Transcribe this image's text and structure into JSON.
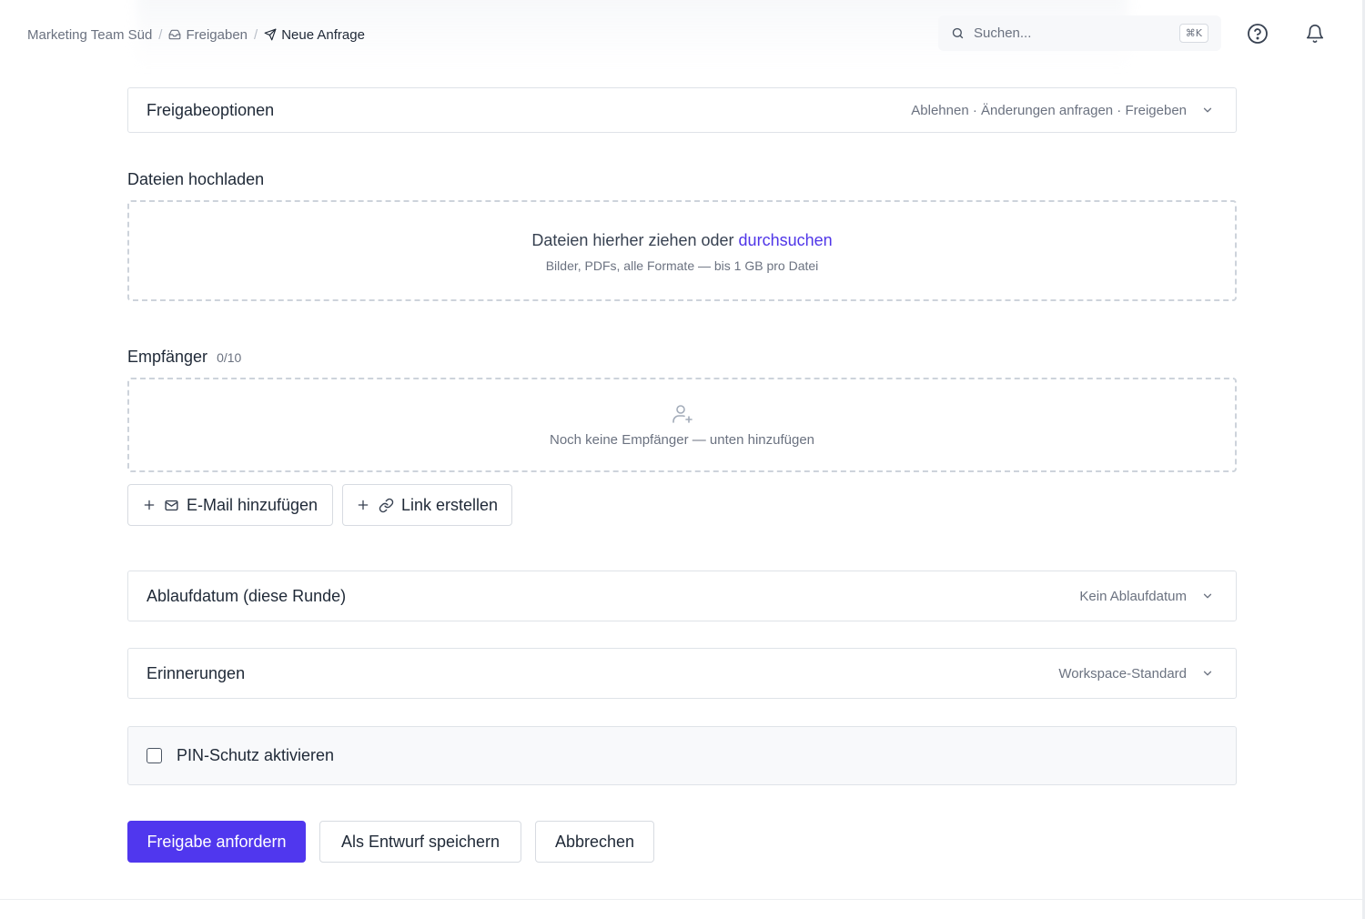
{
  "breadcrumb": {
    "workspace": "Marketing Team Süd",
    "section": "Freigaben",
    "current": "Neue Anfrage",
    "separator": "/"
  },
  "search": {
    "placeholder": "Suchen...",
    "shortcut": "⌘K"
  },
  "header_icons": [
    "help-circle-icon",
    "bell-icon"
  ],
  "approval_options": {
    "title": "Freigabeoptionen",
    "value": "Ablehnen · Änderungen anfragen · Freigeben"
  },
  "upload": {
    "label": "Dateien hochladen",
    "text": "Dateien hierher ziehen oder",
    "link": "durchsuchen",
    "hint": "Bilder, PDFs, alle Formate — bis 1 GB pro Datei"
  },
  "recipients": {
    "label": "Empfänger",
    "count": "0/10",
    "empty_text": "Noch keine Empfänger — unten hinzufügen",
    "add_email": "E-Mail hinzufügen",
    "create_link": "Link erstellen"
  },
  "expiry": {
    "title": "Ablaufdatum (diese Runde)",
    "value": "Kein Ablaufdatum"
  },
  "reminders": {
    "title": "Erinnerungen",
    "value": "Workspace-Standard"
  },
  "pin": {
    "label": "PIN-Schutz aktivieren",
    "checked": false
  },
  "actions": {
    "submit": "Freigabe anfordern",
    "save_draft": "Als Entwurf speichern",
    "cancel": "Abbrechen"
  },
  "colors": {
    "primary": "#5037ee",
    "link": "#4f35e8"
  }
}
